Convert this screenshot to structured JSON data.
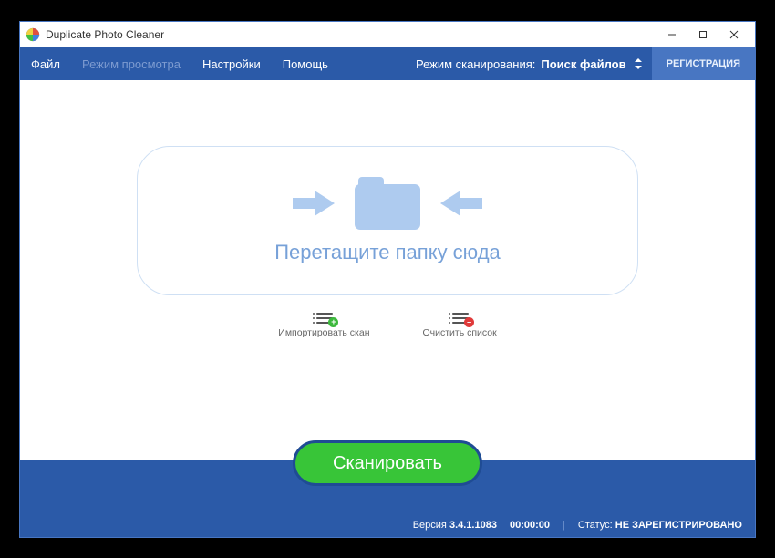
{
  "titlebar": {
    "title": "Duplicate Photo Cleaner"
  },
  "menubar": {
    "file": "Файл",
    "view": "Режим просмотра",
    "settings": "Настройки",
    "help": "Помощь",
    "scan_mode_label": "Режим сканирования:",
    "scan_mode_value": "Поиск файлов",
    "register": "РЕГИСТРАЦИЯ"
  },
  "dropzone": {
    "text": "Перетащите папку сюда"
  },
  "actions": {
    "import": "Импортировать скан",
    "clear": "Очистить список"
  },
  "scan_button": "Сканировать",
  "statusbar": {
    "version_label": "Версия",
    "version_value": "3.4.1.1083",
    "time": "00:00:00",
    "status_label": "Статус:",
    "status_value": "НЕ ЗАРЕГИСТРИРОВАНО"
  }
}
